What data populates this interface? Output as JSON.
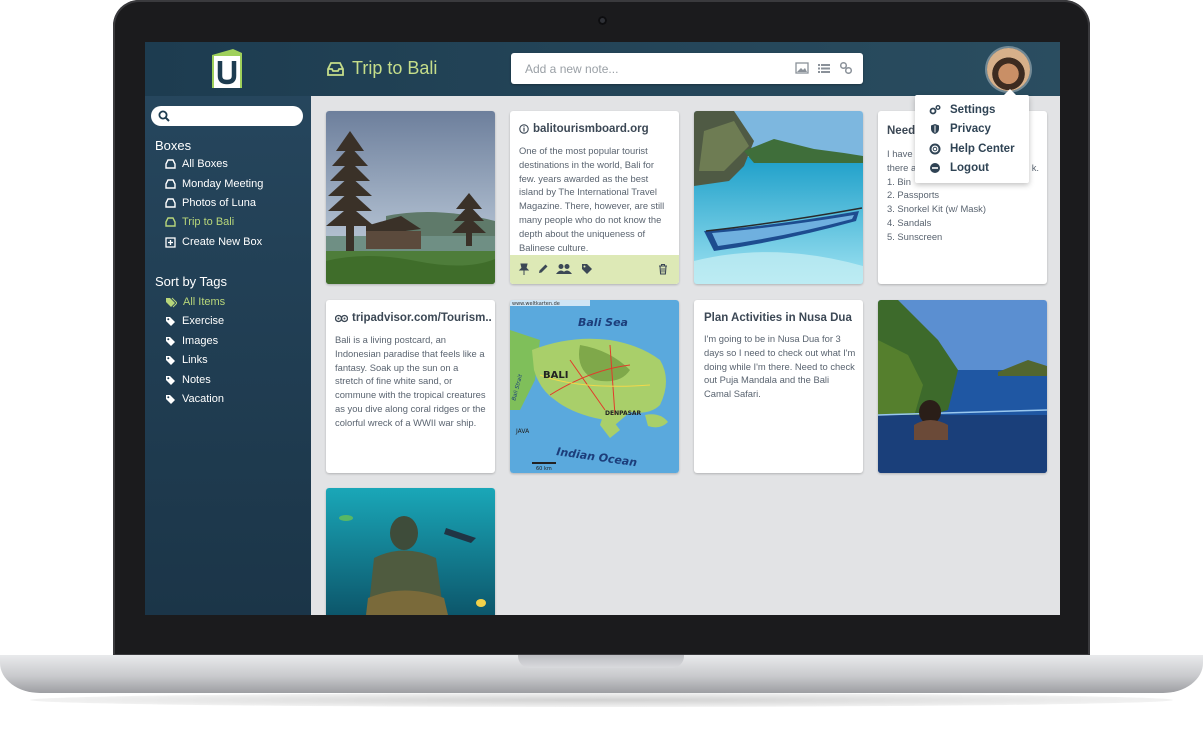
{
  "app": {
    "box_title": "Trip to Bali",
    "add_note_placeholder": "Add a new note..."
  },
  "sidebar": {
    "boxes_heading": "Boxes",
    "boxes": [
      {
        "label": "All Boxes"
      },
      {
        "label": "Monday Meeting"
      },
      {
        "label": "Photos of Luna"
      },
      {
        "label": "Trip to Bali",
        "active": true
      },
      {
        "label": "Create New Box"
      }
    ],
    "tags_heading": "Sort by Tags",
    "tags": [
      {
        "label": "All Items",
        "active": true
      },
      {
        "label": "Exercise"
      },
      {
        "label": "Images"
      },
      {
        "label": "Links"
      },
      {
        "label": "Notes"
      },
      {
        "label": "Vacation"
      }
    ]
  },
  "cards": {
    "bali_tourism": {
      "title": "balitourismboard.org",
      "body": "One of the most popular tourist destinations in the world, Bali for few. years awarded as the best island by The International Travel Magazine.  There, however, are still many people who do not know the depth about the uniqueness of Balinese culture."
    },
    "packing": {
      "title": "Need",
      "intro": "I have",
      "intro2": "there a",
      "intro_tail": "k.",
      "items": [
        "1. Binoculars",
        "2. Passports",
        "3. Snorkel Kit (w/ Mask)",
        "4. Sandals",
        "5. Sunscreen"
      ],
      "item1_visible": "1. Bin"
    },
    "tripadvisor": {
      "title": "tripadvisor.com/Tourism..",
      "body": "Bali is a living postcard, an Indonesian paradise that feels like a fantasy.  Soak up the sun on a stretch of fine white sand, or commune with the tropical creatures as you dive along coral ridges or the colorful wreck of a WWII war ship."
    },
    "map": {
      "sea_north": "Bali Sea",
      "island": "BALI",
      "ocean_south": "Indian Ocean",
      "city": "DENPASAR",
      "left_label": "JAVA",
      "strait": "Bali Strait",
      "scale": "60 km",
      "credit": "www.weltkarten.de"
    },
    "nusa_dua": {
      "title": "Plan Activities in Nusa Dua",
      "body": "I'm going to be in Nusa Dua for 3 days so I need to check out what I'm doing while I'm there.  Need to check out Puja Mandala and the Bali Camal Safari."
    }
  },
  "menu": {
    "items": [
      {
        "label": "Settings",
        "icon": "gears-icon"
      },
      {
        "label": "Privacy",
        "icon": "shield-icon"
      },
      {
        "label": "Help Center",
        "icon": "lifebuoy-icon"
      },
      {
        "label": "Logout",
        "icon": "minus-circle-icon"
      }
    ]
  },
  "colors": {
    "accent_green": "#b8d67a",
    "sidebar": "#1f3c51",
    "topbar": "#22425a"
  }
}
